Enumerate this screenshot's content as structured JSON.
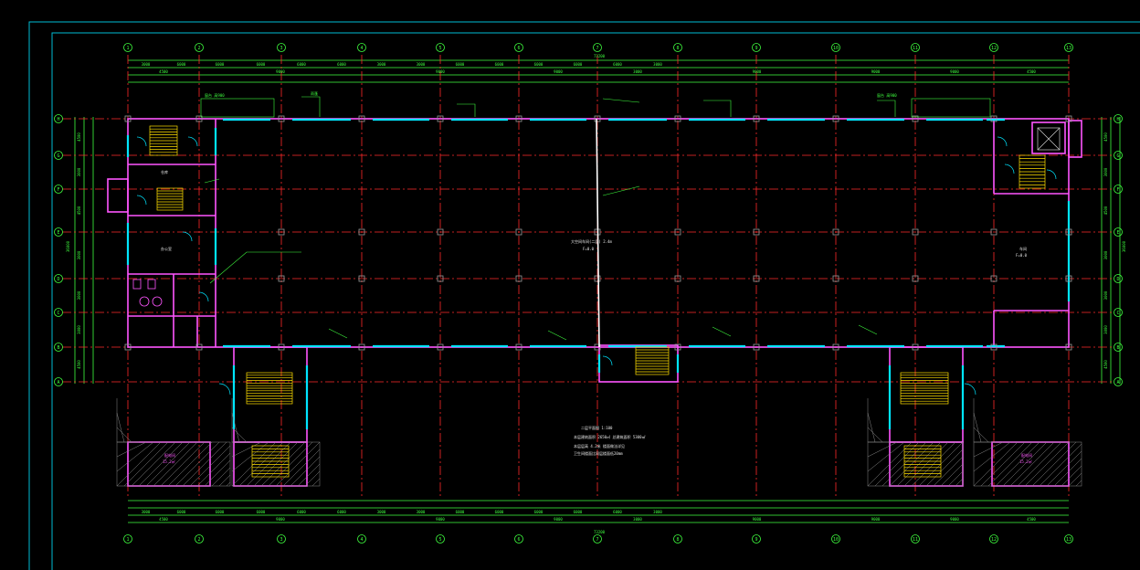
{
  "colors": {
    "background": "#000000",
    "frame": "#00bcd4",
    "grid_axis": "#ff2a2a",
    "dimension": "#3fff3f",
    "wall": "#ff55ff",
    "window": "#00e5ff",
    "stair": "#ffe000",
    "text": "#e8e8e8",
    "column": "#9a9a9a",
    "room_label": "#ff55ff"
  },
  "axes": {
    "columns": [
      "1",
      "2",
      "3",
      "4",
      "5",
      "6",
      "7",
      "8",
      "9",
      "10",
      "11",
      "12",
      "13"
    ],
    "rows": [
      "H",
      "G",
      "F",
      "E",
      "D",
      "C",
      "B",
      "A"
    ]
  },
  "dims": {
    "top_row1": [
      "3000",
      "6000",
      "6000",
      "6000",
      "6000",
      "6000",
      "3000",
      "3000",
      "6000",
      "6000",
      "6000",
      "6000",
      "6000",
      "3000"
    ],
    "top_row2": [
      "4500",
      "9000",
      "9000",
      "9000",
      "3000",
      "9000",
      "9000",
      "9000",
      "4500"
    ],
    "top_total": "73200",
    "side_dims": [
      "4500",
      "3000",
      "4500",
      "3000",
      "3000",
      "3000",
      "4500"
    ],
    "side_total": "36000"
  },
  "labels": {
    "hall_center": "大空间车间(二层) 2.4m",
    "hall_center_sub": "F=0.0",
    "room_right": "车间",
    "room_right_sub": "F=0.0",
    "office": "办公室",
    "storage": "仓库",
    "tag_left1": "窗台 高900",
    "tag_left2": "雨蓬",
    "tag_right1": "窗台 高900",
    "pink_left": "配电间",
    "pink_left_sub": "15.2㎡",
    "pink_right": "配电间",
    "pink_right_sub": "15.2㎡"
  },
  "notes": {
    "title": "二层平面图 1:100",
    "line1": "本层建筑面积 2650㎡ 总建筑面积 5300㎡",
    "line2": "本层层高 4.2米 楼面做法详见",
    "line3": "卫生间楼面比同层楼面低20mm"
  }
}
